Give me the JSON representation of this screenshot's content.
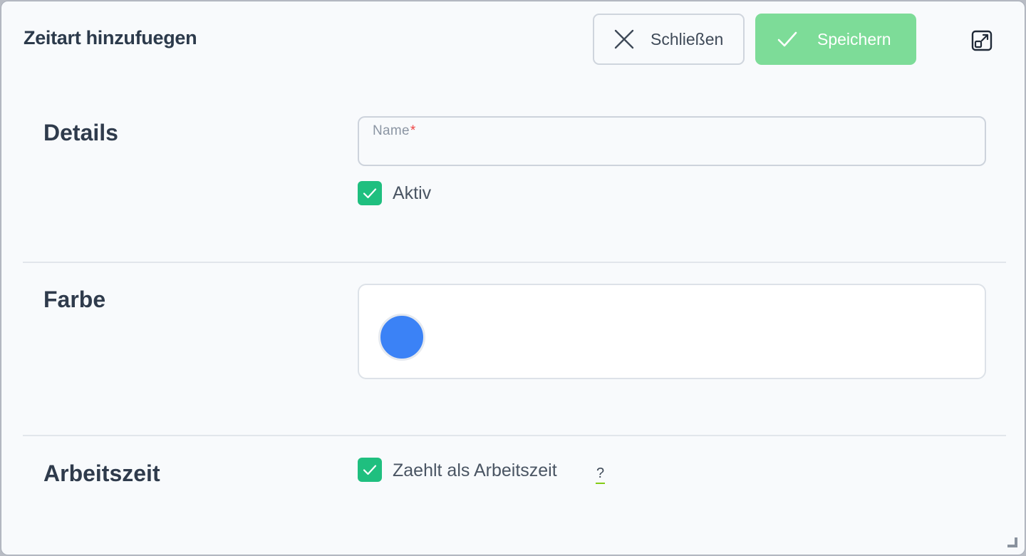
{
  "dialog": {
    "title": "Zeitart hinzufuegen",
    "close_label": "Schließen",
    "save_label": "Speichern"
  },
  "details": {
    "heading": "Details",
    "name_label": "Name",
    "name_required_mark": "*",
    "name_value": "",
    "active_label": "Aktiv",
    "active_checked": true
  },
  "color": {
    "heading": "Farbe",
    "selected_color": "#3b82f6"
  },
  "worktime": {
    "heading": "Arbeitszeit",
    "counts_label": "Zaehlt als Arbeitszeit",
    "counts_checked": true,
    "help_mark": "?"
  },
  "icons": {
    "close": "close-icon",
    "save": "check-icon",
    "expand": "expand-icon"
  },
  "colors": {
    "accent_green": "#1fbf7f",
    "save_button": "#7ddc98",
    "required": "#ef4444"
  }
}
